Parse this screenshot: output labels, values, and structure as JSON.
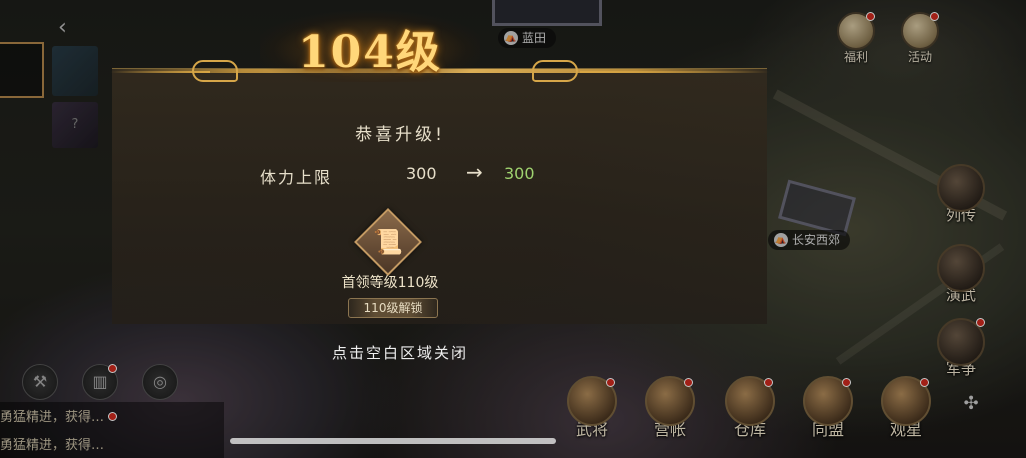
{
  "map": {
    "labels": [
      {
        "text": "蓝田"
      },
      {
        "text": "长安西郊"
      }
    ]
  },
  "top_right": [
    {
      "label": "福利",
      "icon": "gift-bag-icon",
      "badge": true
    },
    {
      "label": "活动",
      "icon": "event-icon",
      "badge": true
    }
  ],
  "side_buttons": [
    {
      "label": "列传",
      "icon": "scroll-icon",
      "badge": false
    },
    {
      "label": "演武",
      "icon": "crossed-swords-icon",
      "badge": false
    },
    {
      "label": "军争",
      "icon": "war-drum-icon",
      "badge": true
    }
  ],
  "bottom_buttons": [
    {
      "label": "武将",
      "icon": "general-helmet-icon",
      "badge": true
    },
    {
      "label": "营帐",
      "icon": "tent-icon",
      "badge": true
    },
    {
      "label": "仓库",
      "icon": "warehouse-icon",
      "badge": true
    },
    {
      "label": "同盟",
      "icon": "alliance-banner-icon",
      "badge": true
    },
    {
      "label": "观星",
      "icon": "star-gazing-icon",
      "badge": true
    }
  ],
  "chat": [
    {
      "text": "勇猛精进，获得…"
    },
    {
      "text": "勇猛精进，获得…"
    }
  ],
  "level_up": {
    "title": "104级",
    "congrats": "恭喜升级!",
    "stat_name": "体力上限",
    "stat_old": "300",
    "arrow": "→",
    "stat_new": "300",
    "unlock_name": "首领等级110级",
    "unlock_badge": "110级解锁",
    "close_hint": "点击空白区域关闭"
  },
  "colors": {
    "title_gold": "#ffd77a",
    "new_value_green": "#9fd36f",
    "badge_red": "#d02a1e"
  }
}
